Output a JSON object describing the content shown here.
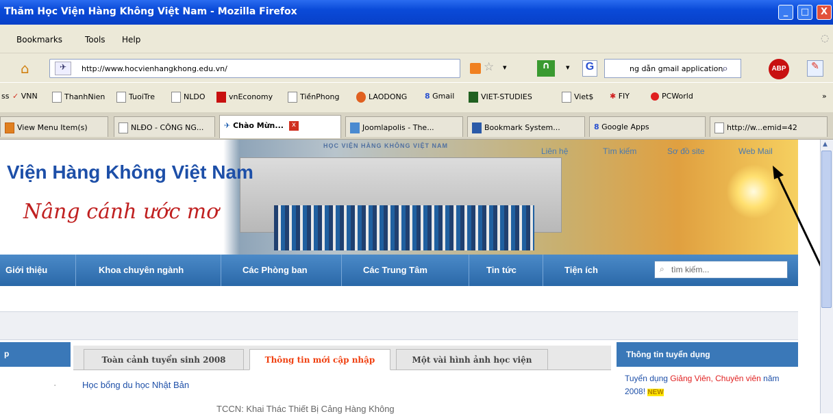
{
  "window": {
    "title": "Thăm Học Viện Hàng Không Việt Nam - Mozilla Firefox",
    "minimize": "_",
    "maximize": "□",
    "close": "X"
  },
  "menu": [
    "Bookmarks",
    "Tools",
    "Help"
  ],
  "nav": {
    "url": "http://www.hocvienhangkhong.edu.vn/",
    "search_value": "ng dẫn gmail application",
    "search_engine": "G",
    "abp": "ABP"
  },
  "bookmarks": [
    "ss",
    "VNN",
    "ThanhNien",
    "TuoiTre",
    "NLDO",
    "vnEconomy",
    "TiềnPhong",
    "LAODONG",
    "Gmail",
    "VIET-STUDIES",
    "Viet$",
    "FIY",
    "PCWorld",
    "»"
  ],
  "tabs": [
    "View Menu Item(s)",
    "NLĐO - CÔNG NG...",
    "Chào Mừn...",
    "Joomlapolis - The...",
    "Bookmark System...",
    "Google Apps",
    "http://w...emid=42"
  ],
  "page": {
    "banner_caption": "HỌC VIỆN HÀNG KHÔNG VIỆT NAM",
    "top_links": [
      "Liên hệ",
      "Tìm kiếm",
      "Sơ đồ site",
      "Web Mail"
    ],
    "site_title": "Viện Hàng Không Việt Nam",
    "slogan": "Nâng cánh ước mơ",
    "nav_items": [
      "Giới thiệu",
      "Khoa chuyên ngành",
      "Các Phòng ban",
      "Các Trung Tâm",
      "Tin tức",
      "Tiện ích"
    ],
    "search_placeholder": "tìm kiếm...",
    "left_header": "p",
    "tabs": [
      "Toàn cảnh tuyển sinh 2008",
      "Thông tin mới cập nhập",
      "Một vài hình ảnh học viện"
    ],
    "right_header": "Thông tin tuyển dụng",
    "news": [
      "Học bổng du học Nhật Bản",
      "TCCN: Khai Thác Thiết Bị Cảng Hàng Không"
    ],
    "recruit": {
      "pre": "Tuyển dụng ",
      "hl1": "Giảng Viên, Chuyên viên",
      "post": " năm 2008! ",
      "badge": "NEW"
    }
  },
  "colors": {
    "titlebar": "#0a4ad8",
    "nav_blue": "#2a68a8",
    "link_blue": "#1d4fa8",
    "active_tab_text": "#f04010"
  }
}
